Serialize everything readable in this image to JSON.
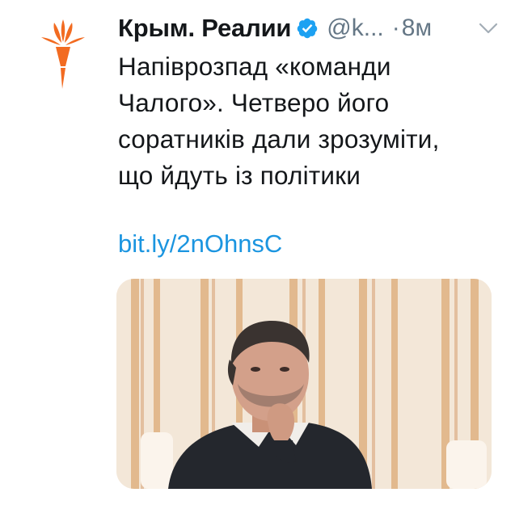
{
  "tweet": {
    "author": {
      "display_name": "Крым. Реалии",
      "handle": "@k...",
      "verified": true,
      "avatar_icon": "rfe-rl-torch-logo-icon"
    },
    "separator": "·",
    "timestamp": "8м",
    "menu_icon": "chevron-down-icon",
    "text": "Напіврозпад «команди\nЧалого». Четверо його\nсоратників дали зрозуміти,\nщо йдуть із політики",
    "link": "bit.ly/2nOhnsC",
    "media": {
      "type": "photo",
      "description_icon": "photo-portrait"
    }
  },
  "colors": {
    "brand_orange": "#f26b21",
    "link_blue": "#1b95e0",
    "verified_blue": "#1da1f2",
    "text_primary": "#14171a",
    "text_secondary": "#657786"
  }
}
